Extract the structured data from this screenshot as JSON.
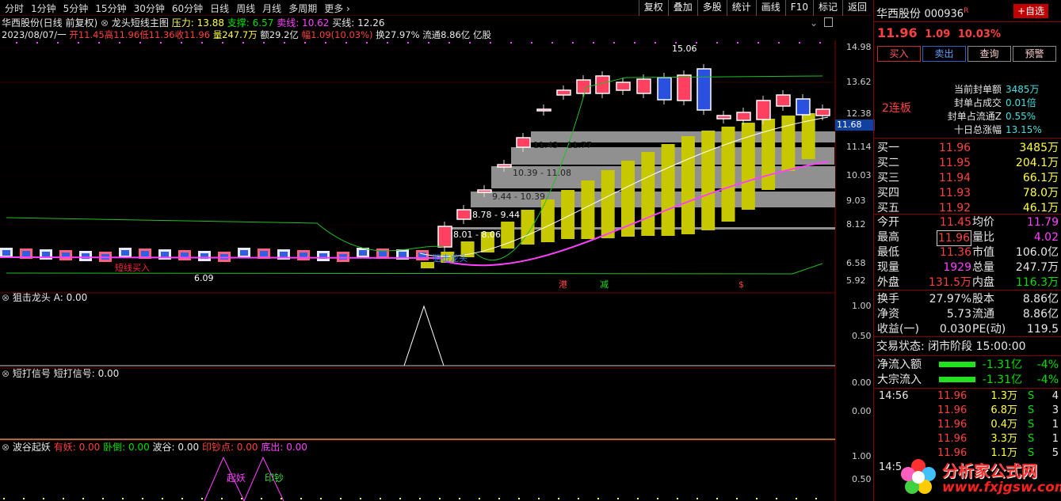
{
  "periods": [
    "分时",
    "1分钟",
    "5分钟",
    "15分钟",
    "30分钟",
    "60分钟",
    "日线",
    "周线",
    "月线",
    "多周期",
    "更多 ›"
  ],
  "tools": [
    "复权",
    "叠加",
    "多股",
    "统计",
    "画线",
    "F10",
    "标记",
    "返回"
  ],
  "title_line": {
    "name": "华西股份(日线 前复权)",
    "indicator": "龙头短线主图",
    "pressure": "压力: 13.88",
    "support": "支撑: 6.57",
    "sell": "卖线: 10.62",
    "buy": "买线: 12.26"
  },
  "info_line": {
    "date": "2023/08/07/一",
    "open": "开11.45",
    "high": "高11.96",
    "low": "低11.36",
    "close": "收11.96",
    "vol": "量247.7万",
    "amt": "额29.2亿",
    "chg": "幅1.09(10.03%)",
    "turn": "换27.97%",
    "float": "流通8.86亿",
    "unit": "亿股"
  },
  "price_axis": [
    "14.98",
    "13.62",
    "12.38",
    "11.14",
    "10.03",
    "9.03",
    "8.12",
    "6.58",
    "5.92"
  ],
  "current_price_tag": "11.68",
  "annotations": {
    "peak": "15.06",
    "low": "6.09",
    "gap1": "11.43 - 11.77",
    "gap2": "10.39 - 11.08",
    "gap3": "9.44 - 10.39",
    "gap4": "8.78 - 9.44",
    "gap5": "8.01 - 8.06",
    "signal1": "狙击龙头",
    "signal2": "短线买入",
    "m1": "港",
    "m2": "减",
    "m3": "$"
  },
  "panels": {
    "p1": {
      "name": "狙击龙头",
      "value": "A: 0.00",
      "axis": [
        "1.00",
        "0.50"
      ]
    },
    "p2": {
      "name": "短打信号",
      "value": "短打信号: 0.00",
      "axis": [
        "0.00",
        "0.00"
      ]
    },
    "p3": {
      "name": "波谷起妖",
      "v1": "有妖: 0.00",
      "v2": "卧倒: 0.00",
      "v3": "波谷: 0.00",
      "v4": "印钞点: 0.00",
      "v5": "底出: 0.00",
      "axis": [
        "1.00",
        "0.50"
      ],
      "lbl1": "起妖",
      "lbl2": "印钞"
    }
  },
  "right": {
    "name": "华西股份",
    "code": "000936",
    "flag": "R",
    "addfav": "+自选",
    "price": "11.96",
    "chg": "1.09",
    "pct": "10.03%",
    "buttons": [
      "买入",
      "卖出",
      "查询",
      "预警"
    ],
    "board": "2连板",
    "stats": [
      [
        "当前封单额",
        "3485万"
      ],
      [
        "封单占成交",
        "0.01倍"
      ],
      [
        "封单占流通Z",
        "0.55%"
      ],
      [
        "十日总涨幅",
        "13.15%"
      ]
    ],
    "bids": [
      [
        "买一",
        "11.96",
        "3485万"
      ],
      [
        "买二",
        "11.95",
        "204.1万"
      ],
      [
        "买三",
        "11.94",
        "66.1万"
      ],
      [
        "买四",
        "11.93",
        "78.0万"
      ],
      [
        "买五",
        "11.92",
        "46.1万"
      ]
    ],
    "quote": [
      [
        "今开",
        "11.45",
        "均价",
        "11.79"
      ],
      [
        "最高",
        "11.96",
        "量比",
        "4.02"
      ],
      [
        "最低",
        "11.36",
        "市值",
        "106.0亿"
      ],
      [
        "现量",
        "1929",
        "总量",
        "247.7万"
      ],
      [
        "外盘",
        "131.5万",
        "内盘",
        "116.3万"
      ]
    ],
    "fund": [
      [
        "换手",
        "27.97%",
        "股本",
        "8.86亿"
      ],
      [
        "净资",
        "5.73",
        "流通",
        "8.86亿"
      ],
      [
        "收益(一)",
        "0.030",
        "PE(动)",
        "119.5"
      ]
    ],
    "status": "交易状态: 闭市阶段",
    "time": "15:00:00",
    "flows": [
      [
        "净流入额",
        "-1.31亿",
        "-4%"
      ],
      [
        "大宗流入",
        "-1.31亿",
        "-4%"
      ]
    ],
    "ticks": [
      [
        "14:56",
        "11.96",
        "1.3万",
        "S",
        "4"
      ],
      [
        "",
        "11.96",
        "6.8万",
        "S",
        "3"
      ],
      [
        "",
        "11.96",
        "0.4万",
        "S",
        "1"
      ],
      [
        "",
        "11.96",
        "3.3万",
        "S",
        "1"
      ],
      [
        "",
        "11.96",
        "1.1万",
        "S",
        "5"
      ],
      [
        "14:5",
        "",
        "",
        "",
        ""
      ]
    ],
    "watermark_cn": "分析家公式网",
    "watermark_url": "www.fxjgsw.com"
  }
}
